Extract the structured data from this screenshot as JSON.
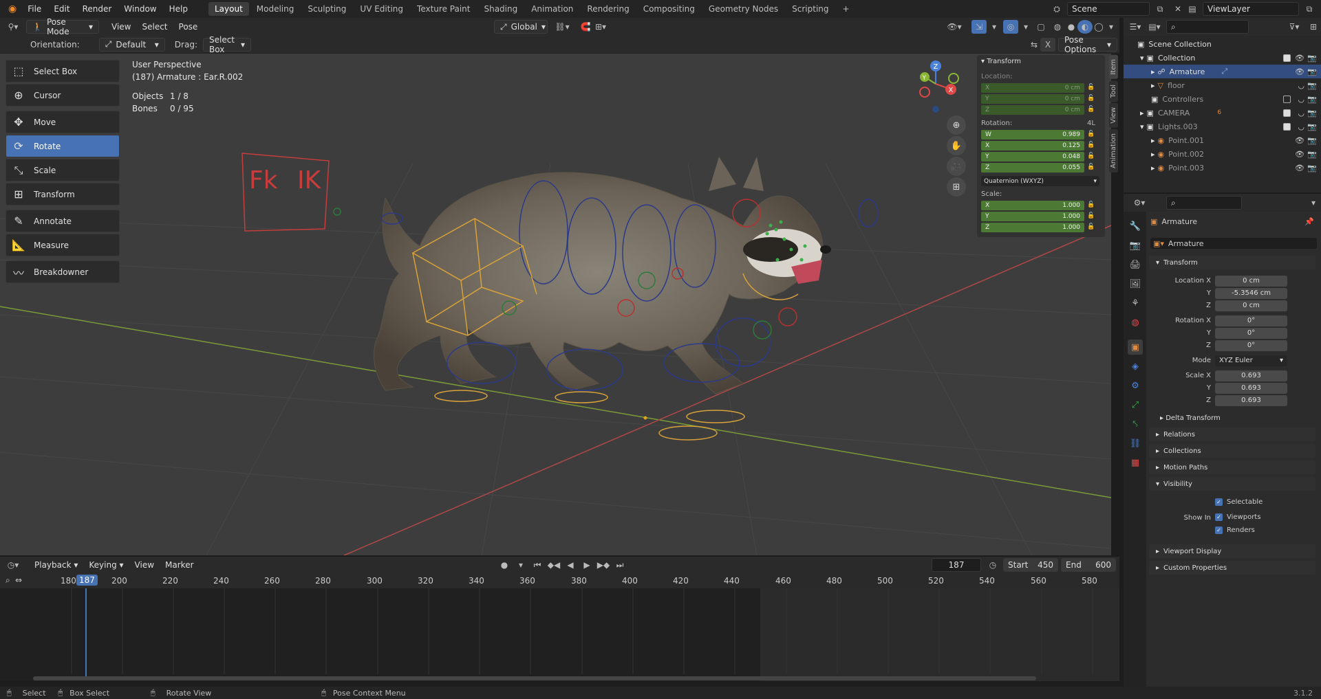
{
  "topbar": {
    "menus": [
      "File",
      "Edit",
      "Render",
      "Window",
      "Help"
    ],
    "workspaces": [
      "Layout",
      "Modeling",
      "Sculpting",
      "UV Editing",
      "Texture Paint",
      "Shading",
      "Animation",
      "Rendering",
      "Compositing",
      "Geometry Nodes",
      "Scripting"
    ],
    "active_workspace": "Layout",
    "add_tab": "+",
    "scene": "Scene",
    "view_layer": "ViewLayer"
  },
  "viewport_header": {
    "mode": "Pose Mode",
    "menus": [
      "View",
      "Select",
      "Pose"
    ],
    "transform_orientation": "Global"
  },
  "tool_header": {
    "orientation_label": "Orientation:",
    "orientation_value": "Default",
    "drag_label": "Drag:",
    "drag_value": "Select Box",
    "x_label": "X",
    "pose_options": "Pose Options"
  },
  "toolbar": {
    "tools": [
      {
        "label": "Select Box",
        "icon": "select-box-icon",
        "glyph": "⬚"
      },
      {
        "label": "Cursor",
        "icon": "cursor-icon",
        "glyph": "⊕"
      },
      {
        "label": "Move",
        "icon": "move-icon",
        "glyph": "✥"
      },
      {
        "label": "Rotate",
        "icon": "rotate-icon",
        "glyph": "⟳"
      },
      {
        "label": "Scale",
        "icon": "scale-icon",
        "glyph": "⤡"
      },
      {
        "label": "Transform",
        "icon": "transform-icon",
        "glyph": "⊞"
      },
      {
        "label": "Annotate",
        "icon": "annotate-icon",
        "glyph": "✎"
      },
      {
        "label": "Measure",
        "icon": "measure-icon",
        "glyph": "📐"
      },
      {
        "label": "Breakdowner",
        "icon": "breakdowner-icon",
        "glyph": "〰"
      }
    ],
    "active_tool": "Rotate"
  },
  "overlay": {
    "view_name": "User Perspective",
    "active_info": "(187) Armature : Ear.R.002",
    "objects_label": "Objects",
    "objects_value": "1 / 8",
    "bones_label": "Bones",
    "bones_value": "0 / 95"
  },
  "rig_labels": {
    "fk": "Fk",
    "ik": "IK"
  },
  "gizmo": {
    "x": "X",
    "y": "Y",
    "z": "Z"
  },
  "npanel": {
    "title": "Transform",
    "location_label": "Location:",
    "location": [
      {
        "axis": "X",
        "value": "0 cm"
      },
      {
        "axis": "Y",
        "value": "0 cm"
      },
      {
        "axis": "Z",
        "value": "0 cm"
      }
    ],
    "rotation_label": "Rotation:",
    "rotation_4l": "4L",
    "rotation": [
      {
        "axis": "W",
        "value": "0.989"
      },
      {
        "axis": "X",
        "value": "0.125"
      },
      {
        "axis": "Y",
        "value": "0.048"
      },
      {
        "axis": "Z",
        "value": "0.055"
      }
    ],
    "rotation_mode": "Quaternion (WXYZ)",
    "scale_label": "Scale:",
    "scale": [
      {
        "axis": "X",
        "value": "1.000"
      },
      {
        "axis": "Y",
        "value": "1.000"
      },
      {
        "axis": "Z",
        "value": "1.000"
      }
    ],
    "tabs": [
      "Item",
      "Tool",
      "View",
      "Animation"
    ]
  },
  "outliner": {
    "rows": [
      {
        "label": "Scene Collection",
        "indent": 0,
        "icon": "▣",
        "color": "#ddd"
      },
      {
        "label": "Collection",
        "indent": 1,
        "icon": "▣",
        "color": "#ddd"
      },
      {
        "label": "Armature",
        "indent": 2,
        "icon": "☍",
        "color": "#fff",
        "selected": true
      },
      {
        "label": "floor",
        "indent": 2,
        "icon": "▽",
        "color": "#aaa"
      },
      {
        "label": "Controllers",
        "indent": 1,
        "icon": "▣",
        "color": "#aaa"
      },
      {
        "label": "CAMERA",
        "indent": 1,
        "icon": "▣",
        "color": "#aaa"
      },
      {
        "label": "Lights.003",
        "indent": 1,
        "icon": "▣",
        "color": "#aaa"
      },
      {
        "label": "Point.001",
        "indent": 2,
        "icon": "◉",
        "color": "#999"
      },
      {
        "label": "Point.002",
        "indent": 2,
        "icon": "◉",
        "color": "#999"
      },
      {
        "label": "Point.003",
        "indent": 2,
        "icon": "◉",
        "color": "#999"
      }
    ],
    "camera_badge": "6"
  },
  "properties": {
    "object_name": "Armature",
    "data_name": "Armature",
    "transform_title": "Transform",
    "location_x_label": "Location X",
    "location": {
      "x": "0 cm",
      "y": "-5.3546 cm",
      "z": "0 cm"
    },
    "rotation_x_label": "Rotation X",
    "rotation": {
      "x": "0°",
      "y": "0°",
      "z": "0°"
    },
    "mode_label": "Mode",
    "mode_value": "XYZ Euler",
    "scale_x_label": "Scale X",
    "scale": {
      "x": "0.693",
      "y": "0.693",
      "z": "0.693"
    },
    "y_label": "Y",
    "z_label": "Z",
    "delta_transform": "Delta Transform",
    "sections": [
      "Relations",
      "Collections",
      "Motion Paths"
    ],
    "visibility_title": "Visibility",
    "selectable": "Selectable",
    "show_in": "Show In",
    "viewports": "Viewports",
    "renders": "Renders",
    "viewport_display": "Viewport Display",
    "custom_properties": "Custom Properties"
  },
  "timeline": {
    "menus": [
      "Playback",
      "Keying",
      "View",
      "Marker"
    ],
    "current_frame": "187",
    "start_label": "Start",
    "start": "450",
    "end_label": "End",
    "end": "600",
    "ruler": [
      "180",
      "200",
      "220",
      "240",
      "260",
      "280",
      "300",
      "320",
      "340",
      "360",
      "380",
      "400",
      "420",
      "440",
      "460",
      "480",
      "500",
      "520",
      "540",
      "560",
      "580"
    ],
    "playhead": "187"
  },
  "statusbar": {
    "select": "Select",
    "box_select": "Box Select",
    "rotate_view": "Rotate View",
    "context_menu": "Pose Context Menu",
    "version": "3.1.2"
  },
  "colors": {
    "accent": "#4772b3",
    "field_green": "#4c7a34",
    "axis_x": "#e04848",
    "axis_y": "#8ab636",
    "axis_z": "#4a82db"
  }
}
